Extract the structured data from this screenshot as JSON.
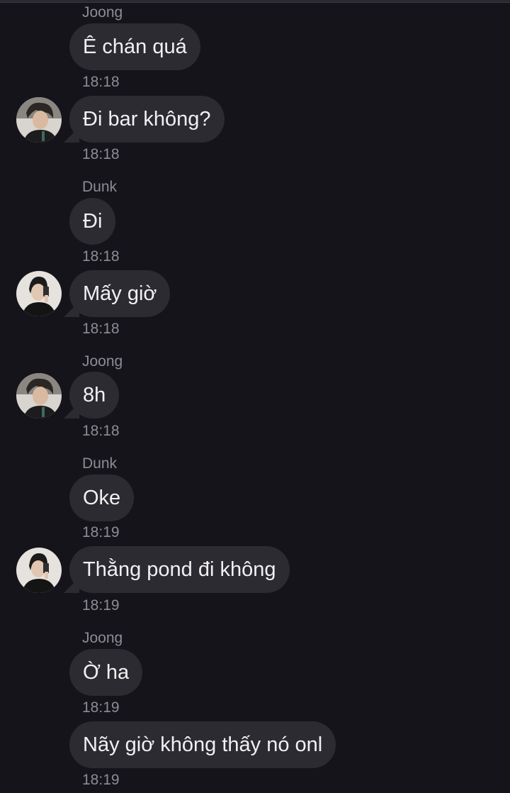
{
  "messages": [
    {
      "sender": "Joong",
      "text": "Ê chán quá",
      "time": "18:18"
    },
    {
      "text": "Đi bar không?",
      "time": "18:18",
      "avatar": "joong-avatar"
    },
    {
      "sender": "Dunk",
      "text": "Đi",
      "time": "18:18"
    },
    {
      "text": "Mấy giờ",
      "time": "18:18",
      "avatar": "dunk-avatar"
    },
    {
      "sender": "Joong",
      "text": "8h",
      "time": "18:18",
      "avatar": "joong-avatar"
    },
    {
      "sender": "Dunk",
      "text": "Oke",
      "time": "18:19"
    },
    {
      "text": "Thằng pond đi không",
      "time": "18:19",
      "avatar": "dunk-avatar"
    },
    {
      "sender": "Joong",
      "text": "Ờ ha",
      "time": "18:19"
    },
    {
      "text": "Nãy giờ không thấy nó onl",
      "time": "18:19"
    }
  ],
  "colors": {
    "background": "#16141b",
    "bubble": "#2c2b31",
    "message_text": "#f1f1f3",
    "meta_text": "#8d8b93"
  }
}
